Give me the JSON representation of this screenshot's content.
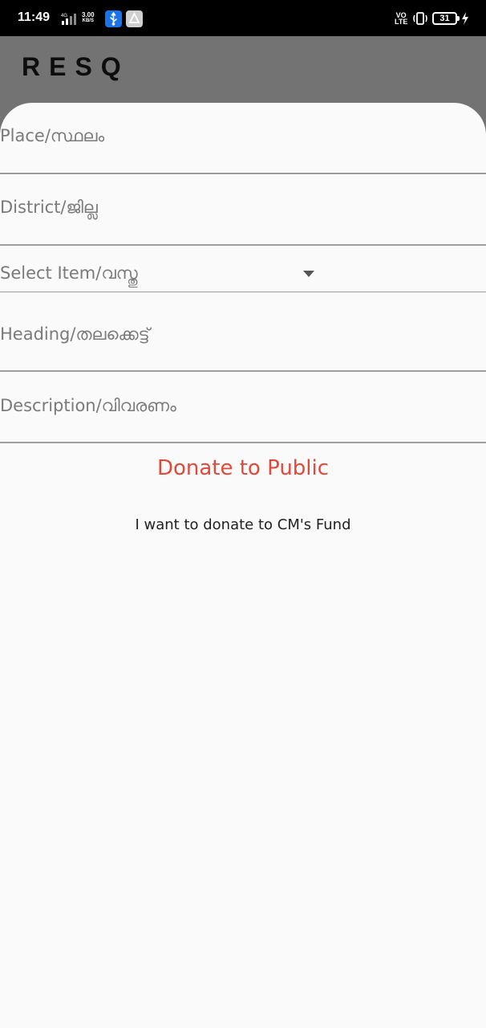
{
  "status_bar": {
    "time": "11:49",
    "network": "4G",
    "speed_value": "3.00",
    "speed_unit": "KB/S",
    "volte_top": "VO",
    "volte_bottom": "LTE",
    "battery": "31",
    "icons": [
      "network-signal-icon",
      "usb-icon",
      "drive-icon",
      "vibrate-icon",
      "charging-icon"
    ]
  },
  "app_bar": {
    "title": "RESQ",
    "background": "#737373"
  },
  "form": {
    "place_placeholder": "Place/സ്ഥലം",
    "district_placeholder": "District/ജില്ല",
    "select_item_label": "Select Item/വസ്തു",
    "heading_placeholder": "Heading/തലക്കെട്ട്",
    "description_placeholder": "Description/വിവരണം"
  },
  "actions": {
    "donate_public": "Donate to Public",
    "donate_cm": "I want to donate to CM's Fund"
  },
  "colors": {
    "accent": "#e04a3a",
    "card_bg": "#fafafa",
    "divider": "#9e9e9e"
  }
}
